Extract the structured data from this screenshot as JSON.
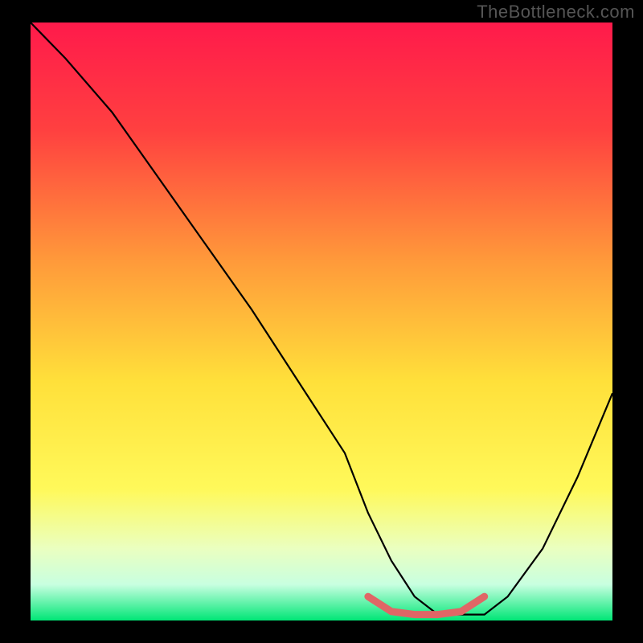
{
  "watermark": "TheBottleneck.com",
  "chart_data": {
    "type": "line",
    "title": "",
    "xlabel": "",
    "ylabel": "",
    "xlim": [
      0,
      100
    ],
    "ylim": [
      0,
      100
    ],
    "gradient_stops": [
      {
        "offset": 0,
        "color": "#ff1a4b"
      },
      {
        "offset": 18,
        "color": "#ff4040"
      },
      {
        "offset": 40,
        "color": "#ff9a3a"
      },
      {
        "offset": 60,
        "color": "#ffe03a"
      },
      {
        "offset": 78,
        "color": "#fff95a"
      },
      {
        "offset": 88,
        "color": "#eaffc0"
      },
      {
        "offset": 94,
        "color": "#c8ffe0"
      },
      {
        "offset": 100,
        "color": "#00e676"
      }
    ],
    "series": [
      {
        "name": "bottleneck-curve",
        "x": [
          0,
          6,
          14,
          22,
          30,
          38,
          46,
          54,
          58,
          62,
          66,
          70,
          74,
          78,
          82,
          88,
          94,
          100
        ],
        "y": [
          100,
          94,
          85,
          74,
          63,
          52,
          40,
          28,
          18,
          10,
          4,
          1,
          1,
          1,
          4,
          12,
          24,
          38
        ]
      }
    ],
    "highlight_segment": {
      "name": "optimal-range",
      "color": "#e06666",
      "x": [
        58,
        62,
        66,
        70,
        74,
        78
      ],
      "y": [
        4,
        1.5,
        1,
        1,
        1.5,
        4
      ]
    }
  }
}
